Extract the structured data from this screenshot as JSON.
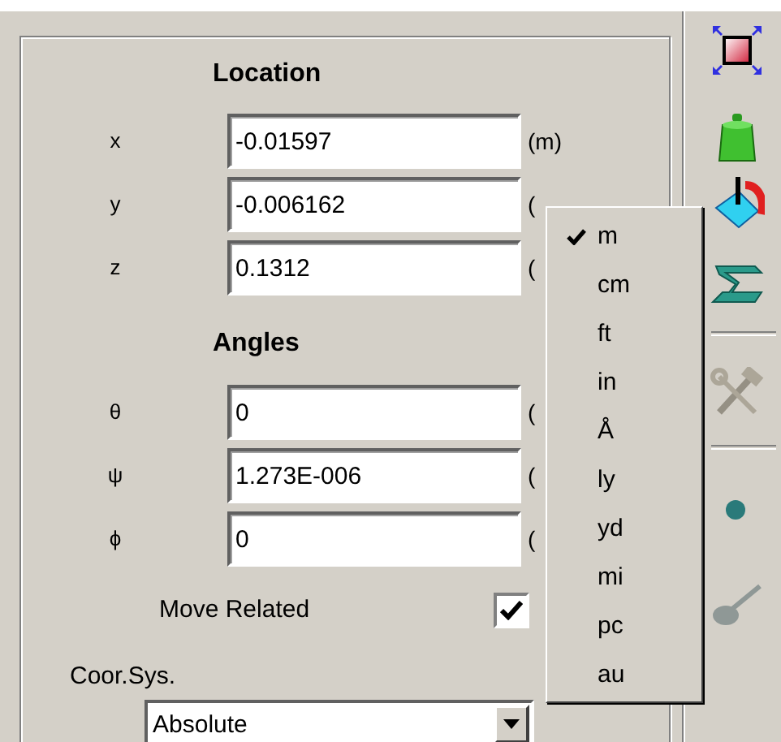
{
  "location": {
    "title": "Location",
    "fields": [
      {
        "label": "x",
        "value": "-0.01597",
        "unit": "(m)"
      },
      {
        "label": "y",
        "value": "-0.006162",
        "unit": "("
      },
      {
        "label": "z",
        "value": "0.1312",
        "unit": "("
      }
    ]
  },
  "angles": {
    "title": "Angles",
    "fields": [
      {
        "label": "θ",
        "value": "0",
        "unit": "("
      },
      {
        "label": "ψ",
        "value": "1.273E-006",
        "unit": "("
      },
      {
        "label": "ϕ",
        "value": "0",
        "unit": "("
      }
    ]
  },
  "move_related": {
    "label": "Move Related",
    "checked": true
  },
  "coord_sys": {
    "label": "Coor.Sys.",
    "value": "Absolute"
  },
  "unit_menu": {
    "items": [
      {
        "label": "m",
        "selected": true
      },
      {
        "label": "cm",
        "selected": false
      },
      {
        "label": "ft",
        "selected": false
      },
      {
        "label": "in",
        "selected": false
      },
      {
        "label": "Å",
        "selected": false
      },
      {
        "label": "ly",
        "selected": false
      },
      {
        "label": "yd",
        "selected": false
      },
      {
        "label": "mi",
        "selected": false
      },
      {
        "label": "pc",
        "selected": false
      },
      {
        "label": "au",
        "selected": false
      }
    ]
  },
  "toolbar": [
    {
      "kind": "button",
      "disabled": false
    },
    {
      "kind": "button",
      "disabled": false
    },
    {
      "kind": "button",
      "disabled": false
    },
    {
      "kind": "button",
      "disabled": false
    },
    {
      "kind": "separator"
    },
    {
      "kind": "button",
      "disabled": true
    },
    {
      "kind": "separator"
    },
    {
      "kind": "button",
      "disabled": false
    },
    {
      "kind": "button",
      "disabled": true
    }
  ]
}
